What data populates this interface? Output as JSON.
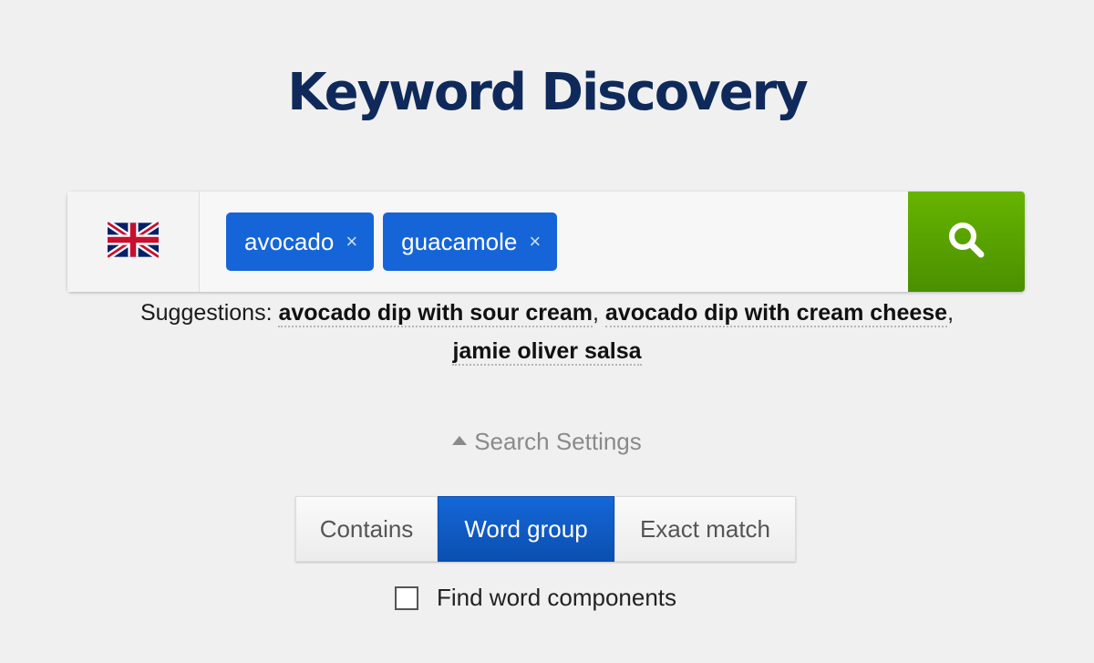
{
  "page": {
    "title": "Keyword Discovery"
  },
  "search": {
    "country_icon": "uk-flag-icon",
    "tags": [
      {
        "label": "avocado",
        "remove_symbol": "×"
      },
      {
        "label": "guacamole",
        "remove_symbol": "×"
      }
    ],
    "button_icon": "search-icon",
    "button_color": "#5aa300"
  },
  "suggestions": {
    "prefix": "Suggestions:",
    "items": [
      "avocado dip with sour cream",
      "avocado dip with cream cheese",
      "jamie oliver salsa"
    ],
    "separator": ","
  },
  "settings": {
    "toggle_label": "Search Settings",
    "toggle_icon": "caret-up-icon",
    "match_options": [
      "Contains",
      "Word group",
      "Exact match"
    ],
    "selected_match": "Word group",
    "find_components_label": "Find word components",
    "find_components_checked": false
  },
  "colors": {
    "title": "#0f2a5a",
    "tag": "#1565d8",
    "active_option": "#0b5ac6",
    "search_button": "#5aa300"
  }
}
